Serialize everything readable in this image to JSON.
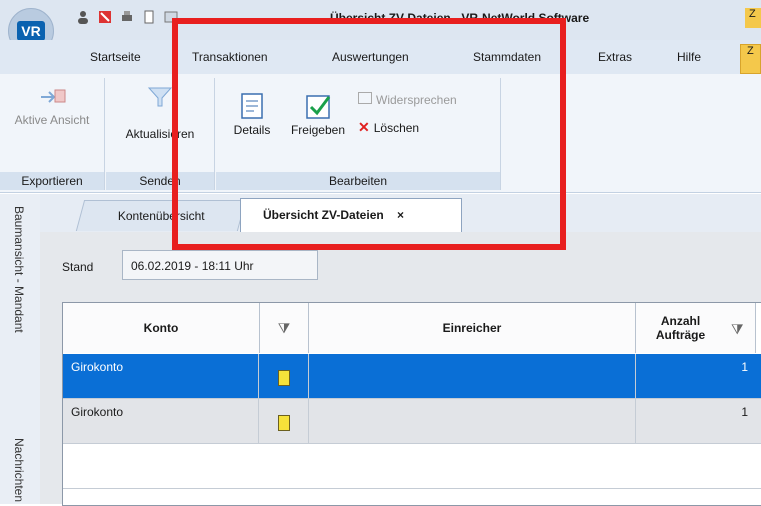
{
  "window": {
    "title": "Übersicht ZV-Dateien - VR-NetWorld Software",
    "title_right_fragment": "Z",
    "logo_text": "VR"
  },
  "menu_tabs": [
    {
      "label": "Startseite"
    },
    {
      "label": "Transaktionen"
    },
    {
      "label": "Auswertungen"
    },
    {
      "label": "Stammdaten"
    },
    {
      "label": "Extras"
    },
    {
      "label": "Hilfe"
    },
    {
      "label": "Z"
    }
  ],
  "ribbon": {
    "groups": [
      {
        "label": "Exportieren",
        "buttons": [
          {
            "label": "Aktive Ansicht"
          }
        ]
      },
      {
        "label": "Senden",
        "buttons": [
          {
            "label": "Aktualisieren"
          }
        ]
      },
      {
        "label": "Bearbeiten",
        "buttons": [
          {
            "label": "Details"
          },
          {
            "label": "Freigeben"
          },
          {
            "label": "Widersprechen"
          },
          {
            "label": "Löschen"
          }
        ]
      }
    ]
  },
  "side_panels": [
    {
      "label": "Baumansicht - Mandant"
    },
    {
      "label": "Nachrichten"
    }
  ],
  "doc_tabs": [
    {
      "label": "Kontenübersicht"
    },
    {
      "label": "Übersicht ZV-Dateien",
      "close": "×"
    }
  ],
  "stand": {
    "label": "Stand",
    "value": "06.02.2019 - 18:11 Uhr"
  },
  "table": {
    "columns": [
      "Konto",
      "",
      "Einreicher",
      "Anzahl Aufträge"
    ],
    "rows": [
      {
        "konto": "Girokonto",
        "einreicher": "",
        "anzahl": "1",
        "selected": true
      },
      {
        "konto": "Girokonto",
        "einreicher": "",
        "anzahl": "1",
        "selected": false
      }
    ]
  },
  "colors": {
    "selected_row": "#0a6fd6",
    "highlight_box": "#e81f1f",
    "ribbon_bg": "#f1f5fa",
    "active_tab": "#f4c84b"
  }
}
